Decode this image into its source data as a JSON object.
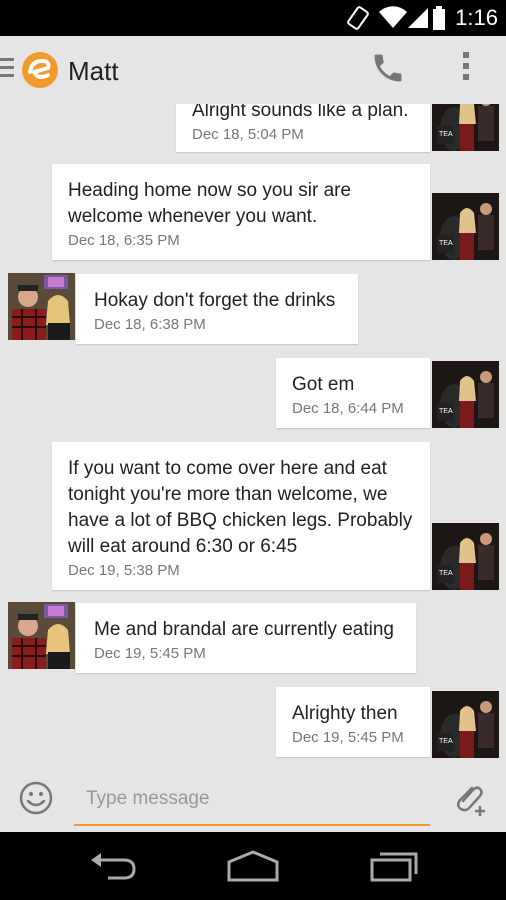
{
  "status_bar": {
    "time": "1:16"
  },
  "app_bar": {
    "title": "Matt"
  },
  "messages": [
    {
      "direction": "outgoing",
      "text": "Alright sounds like a plan.",
      "timestamp": "Dec 18, 5:04 PM"
    },
    {
      "direction": "outgoing",
      "text": "Heading home now so you sir are welcome whenever you want.",
      "timestamp": "Dec 18, 6:35 PM"
    },
    {
      "direction": "incoming",
      "text": "Hokay don't forget the drinks",
      "timestamp": "Dec 18, 6:38 PM"
    },
    {
      "direction": "outgoing",
      "text": "Got em",
      "timestamp": "Dec 18, 6:44 PM"
    },
    {
      "direction": "outgoing",
      "text": "If you want to come over here and eat tonight you're more than welcome, we have a lot of BBQ chicken legs. Probably will eat around 6:30 or 6:45",
      "timestamp": "Dec 19, 5:38 PM"
    },
    {
      "direction": "incoming",
      "text": "Me and brandal are currently eating",
      "timestamp": "Dec 19, 5:45 PM"
    },
    {
      "direction": "outgoing",
      "text": "Alrighty then",
      "timestamp": "Dec 19, 5:45 PM"
    }
  ],
  "composer": {
    "placeholder": "Type message"
  },
  "colors": {
    "accent": "#f29a2e",
    "background": "#e5e5e5",
    "bubble": "#ffffff",
    "timestamp": "#777777"
  },
  "icons": [
    "menu-icon",
    "app-logo-icon",
    "phone-icon",
    "overflow-menu-icon",
    "emoji-icon",
    "attach-icon",
    "back-icon",
    "home-icon",
    "recents-icon"
  ]
}
